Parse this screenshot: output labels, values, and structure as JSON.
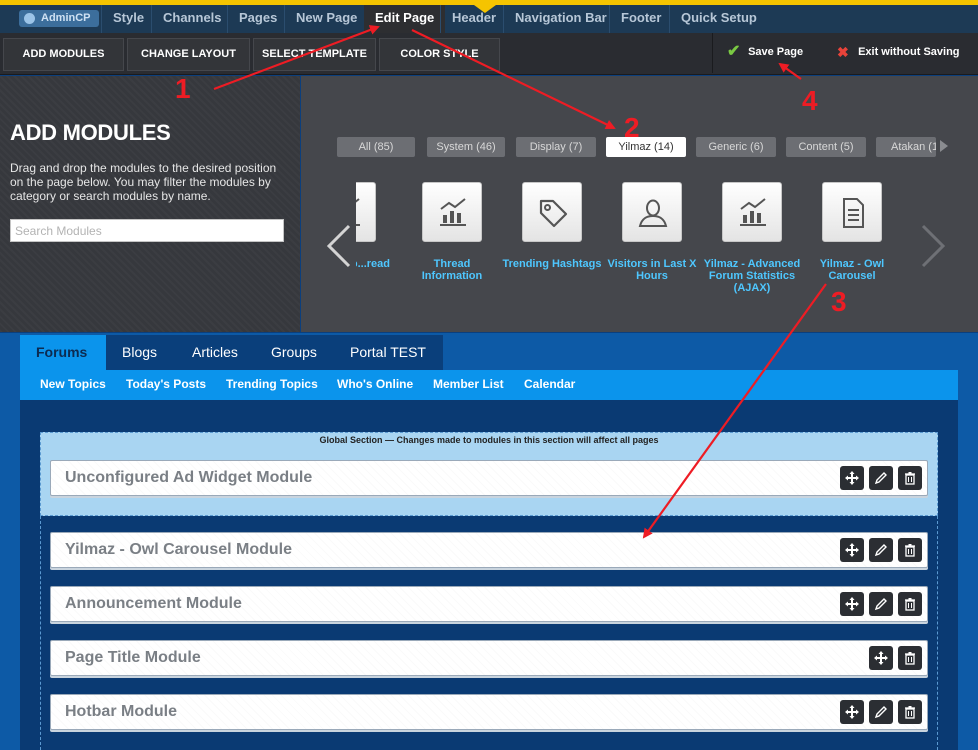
{
  "topbar": {
    "admincp_label": "AdminCP",
    "tabs": [
      {
        "label": "Style"
      },
      {
        "label": "Channels"
      },
      {
        "label": "Pages"
      },
      {
        "label": "New Page"
      },
      {
        "label": "Edit Page"
      },
      {
        "label": "Header"
      },
      {
        "label": "Navigation Bar"
      },
      {
        "label": "Footer"
      },
      {
        "label": "Quick Setup"
      }
    ],
    "accent_color": "#f5c400"
  },
  "toolbar": {
    "buttons": [
      {
        "label": "ADD MODULES"
      },
      {
        "label": "CHANGE LAYOUT"
      },
      {
        "label": "SELECT TEMPLATE"
      },
      {
        "label": "COLOR STYLE"
      }
    ],
    "save_label": "Save Page",
    "exit_label": "Exit without Saving"
  },
  "left_panel": {
    "title": "ADD MODULES",
    "description": "Drag and drop the modules to the desired position on the page below. You may filter the modules by category or search modules by name.",
    "search_placeholder": "Search Modules"
  },
  "module_picker": {
    "filters": [
      {
        "label": "All (85)"
      },
      {
        "label": "System (46)"
      },
      {
        "label": "Display (7)"
      },
      {
        "label": "Yilmaz (14)"
      },
      {
        "label": "Generic (6)"
      },
      {
        "label": "Content (5)"
      },
      {
        "label": "Atakan (1"
      }
    ],
    "active_filter": "Yilmaz (14)",
    "modules": [
      {
        "label": "...read Info...read",
        "icon": "chart-icon"
      },
      {
        "label": "Thread Information",
        "icon": "chart-icon"
      },
      {
        "label": "Trending Hashtags",
        "icon": "tag-icon"
      },
      {
        "label": "Visitors in Last X Hours",
        "icon": "user-icon"
      },
      {
        "label": "Yilmaz - Advanced Forum Statistics (AJAX)",
        "icon": "chart-icon"
      },
      {
        "label": "Yilmaz - Owl Carousel",
        "icon": "document-icon"
      }
    ],
    "link_color": "#4ec7ff"
  },
  "site": {
    "nav_tabs": [
      {
        "label": "Forums"
      },
      {
        "label": "Blogs"
      },
      {
        "label": "Articles"
      },
      {
        "label": "Groups"
      },
      {
        "label": "Portal TEST"
      }
    ],
    "sub_nav": [
      {
        "label": "New Topics"
      },
      {
        "label": "Today's Posts"
      },
      {
        "label": "Trending Topics"
      },
      {
        "label": "Who's Online"
      },
      {
        "label": "Member List"
      },
      {
        "label": "Calendar"
      }
    ],
    "global_section_title": "Global Section — Changes made to modules in this section will affect all pages",
    "global_modules": [
      {
        "name": "Unconfigured Ad Widget Module",
        "editable": true
      }
    ],
    "page_modules": [
      {
        "name": "Yilmaz - Owl Carousel Module",
        "editable": true
      },
      {
        "name": "Announcement Module",
        "editable": true
      },
      {
        "name": "Page Title Module",
        "editable": false
      },
      {
        "name": "Hotbar Module",
        "editable": true
      }
    ]
  },
  "annotations": {
    "numbers": [
      "1",
      "2",
      "3",
      "4"
    ],
    "color": "#ee1c24"
  }
}
